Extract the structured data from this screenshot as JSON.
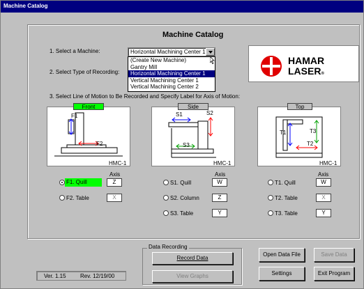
{
  "window": {
    "title": "Machine Catalog"
  },
  "panel": {
    "title": "Machine Catalog"
  },
  "steps": {
    "step1": "1. Select a Machine:",
    "step2": "2. Select Type of Recording:",
    "step3": "3. Select Line of Motion to Be Recorded and Specify Label for Axis of Motion:"
  },
  "machine_select": {
    "value": "Horizontal Machining Center 1",
    "options": [
      "(Create New Machine)",
      "Gantry Mill",
      "Horizontal Machining Center 1",
      "Vertical Machining Center 1",
      "Vertical Machining Center 2"
    ],
    "selected_index": 2
  },
  "logo": {
    "line1": "HAMAR",
    "line2": "LASER",
    "mark": "®",
    "brand_color": "#e00000"
  },
  "views": [
    {
      "label": "Front",
      "active": true,
      "machine_id": "HMC-1",
      "labels": [
        "F1",
        "F2"
      ]
    },
    {
      "label": "Side",
      "active": false,
      "machine_id": "HMC-1",
      "labels": [
        "S1",
        "S2",
        "S3"
      ]
    },
    {
      "label": "Top",
      "active": false,
      "machine_id": "HMC-1",
      "labels": [
        "T1",
        "T2",
        "T3"
      ]
    }
  ],
  "axis_header": "Axis",
  "motions": {
    "front": [
      {
        "label": "F1. Quill",
        "axis": "Z",
        "selected": true,
        "enabled": true
      },
      {
        "label": "F2. Table",
        "axis": "X",
        "selected": false,
        "enabled": false
      }
    ],
    "side": [
      {
        "label": "S1. Quill",
        "axis": "W",
        "selected": false,
        "enabled": true
      },
      {
        "label": "S2. Column",
        "axis": "Z",
        "selected": false,
        "enabled": true
      },
      {
        "label": "S3. Table",
        "axis": "Y",
        "selected": false,
        "enabled": true
      }
    ],
    "top": [
      {
        "label": "T1. Quill",
        "axis": "W",
        "selected": false,
        "enabled": true
      },
      {
        "label": "T2. Table",
        "axis": "X",
        "selected": false,
        "enabled": false
      },
      {
        "label": "T3. Table",
        "axis": "Y",
        "selected": false,
        "enabled": true
      }
    ]
  },
  "data_recording": {
    "title": "Data Recording",
    "record": "Record Data",
    "view": "View Graphs"
  },
  "buttons": {
    "open": "Open Data File",
    "save": "Save Data",
    "settings": "Settings",
    "exit": "Exit Program"
  },
  "status": {
    "version": "Ver. 1.15",
    "revision": "Rev. 12/19/00"
  },
  "colors": {
    "titlebar": "#000080",
    "active_view": "#00ff00",
    "selection": "#000080",
    "arrow_blue": "#0000ff",
    "arrow_red": "#ff0000",
    "arrow_green": "#00a000"
  }
}
